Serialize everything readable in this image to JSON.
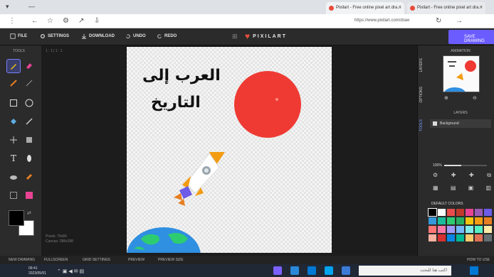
{
  "browser": {
    "tabs": [
      {
        "label": "Pixilart - Free online pixel art dra..."
      },
      {
        "label": "Pixilart - Free online pixel art dra..."
      }
    ],
    "url": "https://www.pixilart.com/draw"
  },
  "header": {
    "menu": {
      "file": "FILE",
      "settings": "SETTINGS",
      "download": "DOWNLOAD",
      "undo": "UNDO",
      "redo": "REDO"
    },
    "logo": "PIXILART",
    "save": "SAVE DRAWING"
  },
  "tools": {
    "title": "TOOLS"
  },
  "canvas": {
    "arabic_line1": "العرب إلى",
    "arabic_line2": "التاريخ",
    "top_label": "1 : 1  | 1 : 1",
    "coords_line1": "Pixels: 79x84",
    "coords_line2": "Canvas: 288x288"
  },
  "sidetabs": {
    "layers": "LAYERS",
    "options": "OPTIONS",
    "tools": "TOOLS"
  },
  "panel": {
    "animation": "ANIMATION",
    "layers": "LAYERS",
    "layer_name": "Background",
    "zoom": "100%",
    "palette_title": "DEFAULT COLORS"
  },
  "status": {
    "new": "NEW DRAWING",
    "fullscreen": "FULLSCREEN",
    "grid": "GRID SETTINGS",
    "preview": "PREVIEW",
    "size": "PREVIEW SIZE",
    "help": "HOW TO USE"
  },
  "taskbar": {
    "clock": "09:41",
    "date": "2023/05/01",
    "search": "اكتب هنا للبحث"
  },
  "palette_colors": [
    "#000000",
    "#ffffff",
    "#e84c4c",
    "#c0392b",
    "#e84393",
    "#9b59b6",
    "#6c5ce7",
    "#3498db",
    "#1abc9c",
    "#2ecc71",
    "#27ae60",
    "#f1c40f",
    "#f39c12",
    "#e67e22",
    "#ff7675",
    "#fd79a8",
    "#a29bfe",
    "#74b9ff",
    "#81ecec",
    "#55efc4",
    "#ffeaa7",
    "#fab1a0",
    "#d63031",
    "#0984e3",
    "#00b894",
    "#fdcb6e",
    "#e17055",
    "#636e72"
  ]
}
